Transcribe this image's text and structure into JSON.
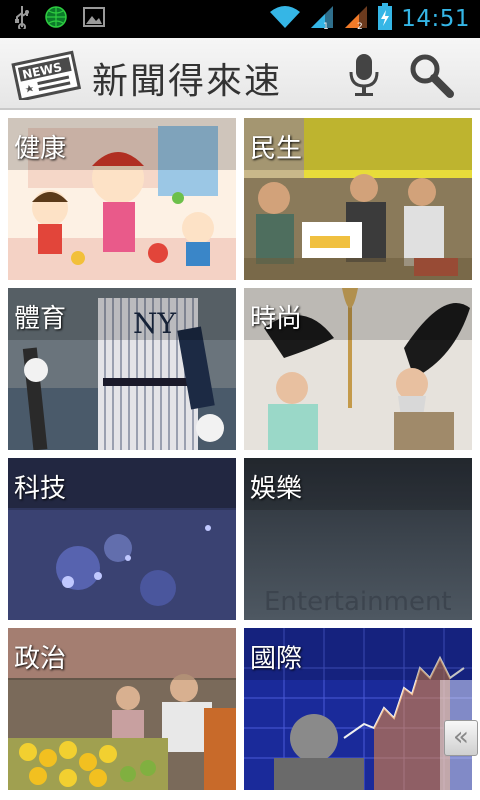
{
  "status_bar": {
    "time": "14:51",
    "icons": [
      "usb-icon",
      "globe-icon",
      "image-icon",
      "wifi-icon",
      "signal-1-icon",
      "signal-2-icon",
      "battery-charging-icon"
    ],
    "accent_color": "#35b6e6"
  },
  "action_bar": {
    "title": "新聞得來速",
    "logo_text": "NEWS",
    "actions": [
      "microphone-icon",
      "search-icon"
    ]
  },
  "categories": [
    {
      "label": "健康"
    },
    {
      "label": "民生"
    },
    {
      "label": "體育"
    },
    {
      "label": "時尚"
    },
    {
      "label": "科技"
    },
    {
      "label": "娛樂",
      "image_text": "Entertainment"
    },
    {
      "label": "政治"
    },
    {
      "label": "國際"
    }
  ],
  "drawer": {
    "handle_label": "«"
  }
}
